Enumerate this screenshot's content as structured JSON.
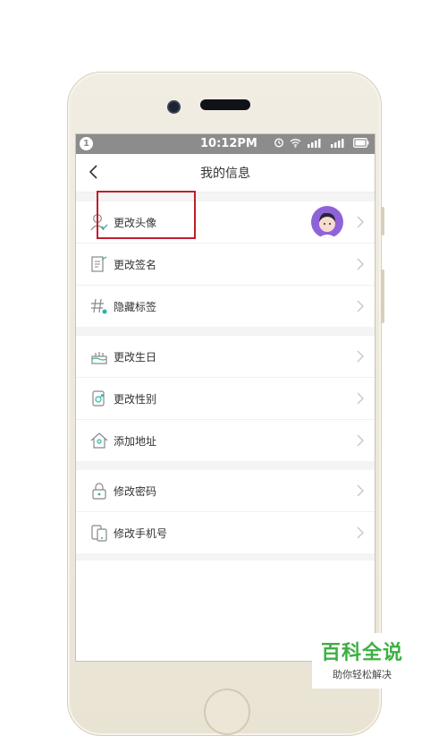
{
  "status_bar": {
    "notification_count": "1",
    "time": "10:12PM"
  },
  "header": {
    "title": "我的信息",
    "back_icon": "chevron-left-icon"
  },
  "sections": [
    {
      "items": [
        {
          "label": "更改头像",
          "icon": "person-icon",
          "has_avatar": true
        },
        {
          "label": "更改签名",
          "icon": "signature-icon"
        },
        {
          "label": "隐藏标签",
          "icon": "hashtag-icon"
        }
      ]
    },
    {
      "items": [
        {
          "label": "更改生日",
          "icon": "cake-icon"
        },
        {
          "label": "更改性别",
          "icon": "gender-icon"
        },
        {
          "label": "添加地址",
          "icon": "home-location-icon"
        }
      ]
    },
    {
      "items": [
        {
          "label": "修改密码",
          "icon": "lock-icon"
        },
        {
          "label": "修改手机号",
          "icon": "phone-icon"
        }
      ]
    }
  ],
  "watermark": {
    "title": "百科全说",
    "subtitle": "助你轻松解决"
  },
  "colors": {
    "highlight": "#c21d2a",
    "icon_accent": "#2bb4a0",
    "avatar_bg": "#8e63d9",
    "watermark_green": "#3db043"
  }
}
